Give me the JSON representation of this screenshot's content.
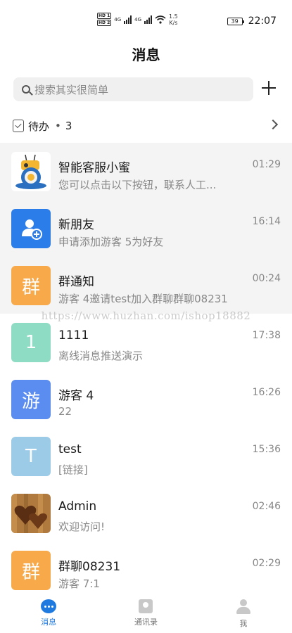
{
  "status_bar": {
    "hd1": "HD 1",
    "hd2": "HD 2",
    "net1": "4G",
    "net2": "4G",
    "speed_value": "1.5",
    "speed_unit": "K/s",
    "battery": "39",
    "time": "22:07"
  },
  "header": {
    "title": "消息"
  },
  "search": {
    "placeholder": "搜索其实很简单"
  },
  "todo": {
    "label": "待办",
    "dot": "•",
    "count": "3"
  },
  "messages": [
    {
      "name": "智能客服小蜜",
      "preview": "您可以点击以下按钮，联系人工...",
      "time": "01:29",
      "avatar_text": "",
      "avatar_color": "#ffffff"
    },
    {
      "name": "新朋友",
      "preview": "申请添加游客 5为好友",
      "time": "16:14",
      "avatar_text": "",
      "avatar_color": "#2b7de9"
    },
    {
      "name": "群通知",
      "preview": "游客 4邀请test加入群聊群聊08231",
      "time": "00:24",
      "avatar_text": "群",
      "avatar_color": "#f8a94a"
    },
    {
      "name": "1111",
      "preview": "离线消息推送演示",
      "time": "17:38",
      "avatar_text": "1",
      "avatar_color": "#8fdcc4"
    },
    {
      "name": "游客 4",
      "preview": "22",
      "time": "16:26",
      "avatar_text": "游",
      "avatar_color": "#5b8cf0"
    },
    {
      "name": "test",
      "preview": "[链接]",
      "time": "15:36",
      "avatar_text": "T",
      "avatar_color": "#9ccbe8"
    },
    {
      "name": "Admin",
      "preview": "欢迎访问!",
      "time": "02:46",
      "avatar_text": "",
      "avatar_color": "#8a5a2b"
    },
    {
      "name": "群聊08231",
      "preview": "游客 7:1",
      "time": "02:29",
      "avatar_text": "群",
      "avatar_color": "#f8a94a"
    }
  ],
  "watermark": "https://www.huzhan.com/ishop18882",
  "nav": {
    "messages": "消息",
    "contacts": "通讯录",
    "me": "我"
  },
  "colors": {
    "accent": "#1f7ae0",
    "group_orange": "#f8a94a"
  }
}
